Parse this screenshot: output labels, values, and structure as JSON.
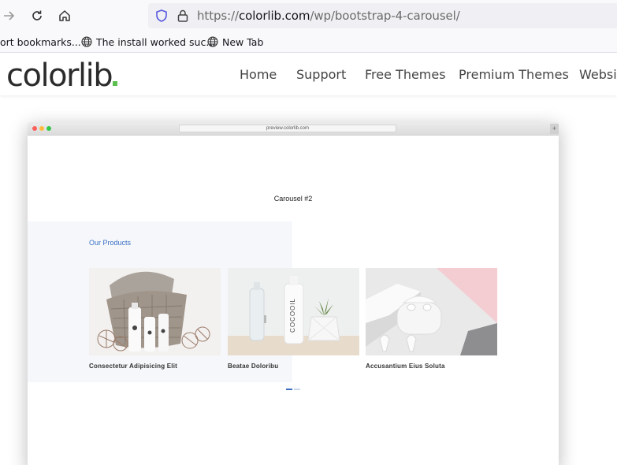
{
  "browser": {
    "url_protocol": "https://",
    "url_host": "colorlib.com",
    "url_path": "/wp/bootstrap-4-carousel/",
    "bookmarks": [
      {
        "label": "ort bookmarks..."
      },
      {
        "label": "The install worked suc..."
      },
      {
        "label": "New Tab"
      }
    ]
  },
  "site": {
    "logo": "colorlib",
    "menu": [
      {
        "label": "Home"
      },
      {
        "label": "Support"
      },
      {
        "label": "Free Themes"
      },
      {
        "label": "Premium Themes"
      },
      {
        "label": "Websit"
      }
    ],
    "accent_color": "#5cbf4f"
  },
  "preview": {
    "url": "preview.colorlib.com",
    "carousel_title": "Carousel #2",
    "products_heading": "Our Products",
    "products": [
      {
        "caption": "Consectetur Adipisicing Elit"
      },
      {
        "caption": "Beatae Doloribu"
      },
      {
        "caption": "Accusantium Eius Soluta"
      }
    ],
    "bottle_label": "COCOOIL",
    "link_color": "#3a6fc4"
  }
}
